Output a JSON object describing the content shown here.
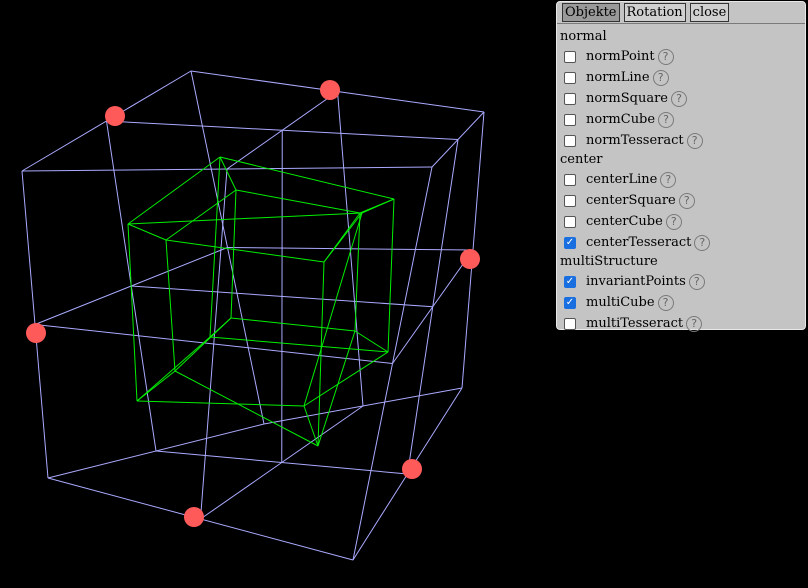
{
  "tabs": [
    {
      "label": "Objekte",
      "active": true
    },
    {
      "label": "Rotation",
      "active": false
    },
    {
      "label": "close",
      "active": false
    }
  ],
  "groups": [
    {
      "title": "normal",
      "items": [
        {
          "label": "normPoint",
          "checked": false
        },
        {
          "label": "normLine",
          "checked": false
        },
        {
          "label": "normSquare",
          "checked": false
        },
        {
          "label": "normCube",
          "checked": false
        },
        {
          "label": "normTesseract",
          "checked": false
        }
      ]
    },
    {
      "title": "center",
      "items": [
        {
          "label": "centerLine",
          "checked": false
        },
        {
          "label": "centerSquare",
          "checked": false
        },
        {
          "label": "centerCube",
          "checked": false
        },
        {
          "label": "centerTesseract",
          "checked": true
        }
      ]
    },
    {
      "title": "multiStructure",
      "items": [
        {
          "label": "invariantPoints",
          "checked": true
        },
        {
          "label": "multiCube",
          "checked": true
        },
        {
          "label": "multiTesseract",
          "checked": false
        }
      ]
    }
  ],
  "help_glyph": "?",
  "colors": {
    "background": "#000000",
    "outer_cube": "#aaaaff",
    "inner_tesseract": "#00ee00",
    "invariant_point": "#ff5a5a",
    "panel": "#c4c4c4"
  }
}
